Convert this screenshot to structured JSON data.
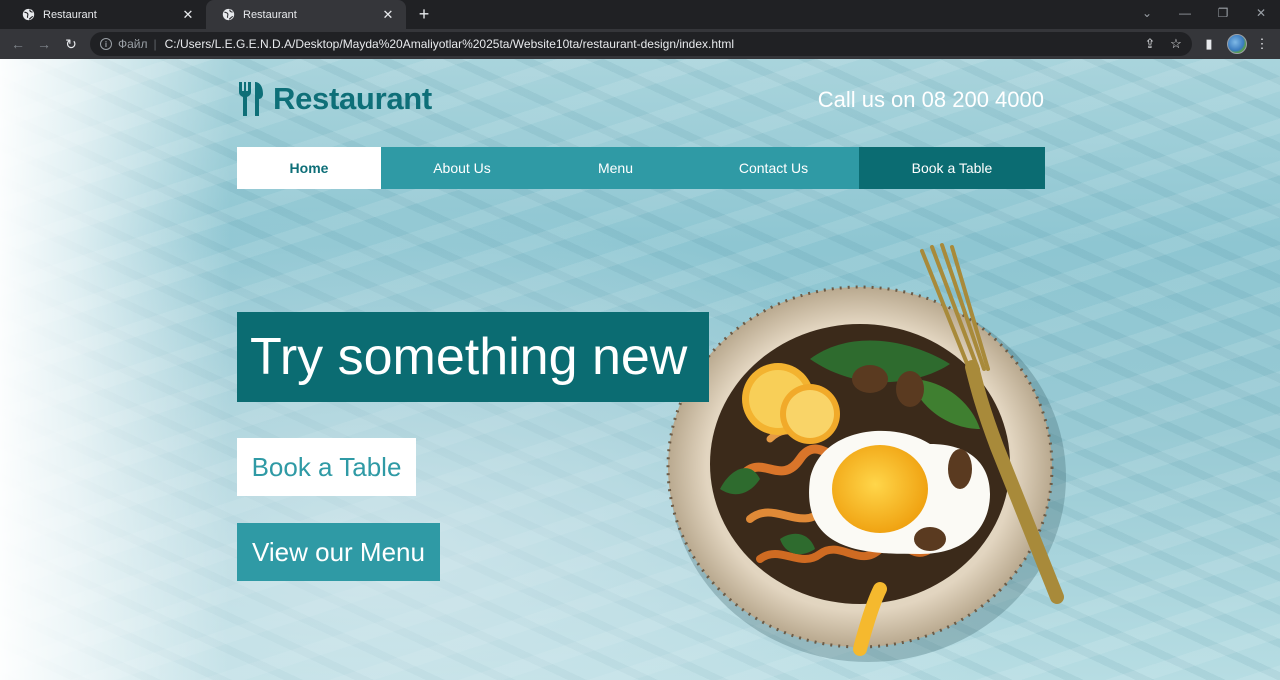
{
  "browser": {
    "tabs": [
      {
        "title": "Restaurant",
        "active": false
      },
      {
        "title": "Restaurant",
        "active": true
      }
    ],
    "address": {
      "scheme_label": "Файл",
      "url": "C:/Users/L.E.G.E.N.D.A/Desktop/Mayda%20Amaliyotlar%2025ta/Website10ta/restaurant-design/index.html"
    },
    "icons": [
      "globe-icon",
      "close-icon",
      "plus-icon",
      "back-icon",
      "forward-icon",
      "reload-icon",
      "info-icon",
      "share-icon",
      "star-icon",
      "side-panel-icon",
      "menu-icon"
    ]
  },
  "site": {
    "logo_text": "Restaurant",
    "phone_text": "Call us on 08 200 4000",
    "nav": {
      "home": "Home",
      "about": "About Us",
      "menu": "Menu",
      "contact": "Contact Us",
      "book": "Book a Table"
    },
    "hero": {
      "title": "Try something new",
      "book_button": "Book a Table",
      "menu_button": "View our Menu"
    },
    "colors": {
      "primary_dark": "#0b6c72",
      "primary": "#2f9aa5",
      "logo": "#0e6f78"
    }
  }
}
